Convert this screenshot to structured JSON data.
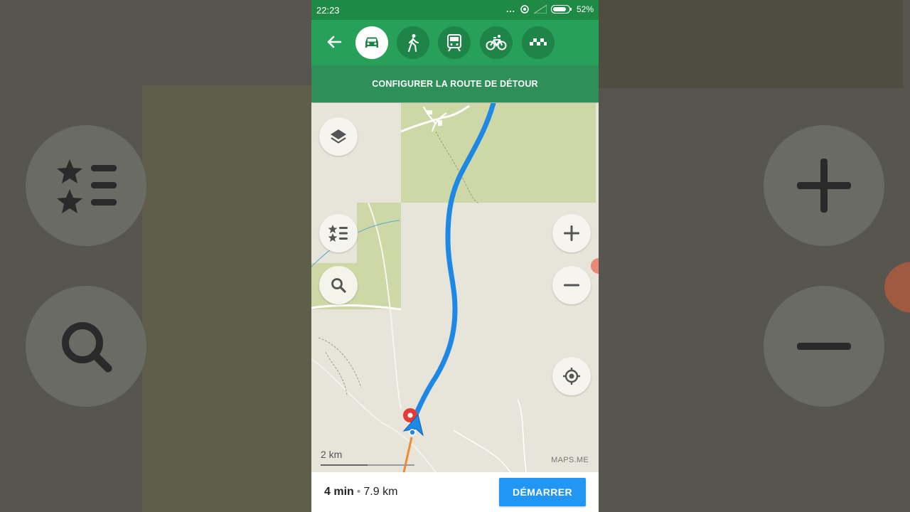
{
  "status_bar": {
    "time": "22:23",
    "dots": "...",
    "battery_percent": "52%"
  },
  "transport_modes": [
    {
      "name": "car",
      "icon": "car-icon",
      "selected": true
    },
    {
      "name": "walk",
      "icon": "walk-icon",
      "selected": false
    },
    {
      "name": "transit",
      "icon": "train-icon",
      "selected": false
    },
    {
      "name": "bicycle",
      "icon": "bicycle-icon",
      "selected": false
    },
    {
      "name": "taxi",
      "icon": "taxi-icon",
      "selected": false
    }
  ],
  "banner": {
    "label": "CONFIGURER LA ROUTE DE DÉTOUR"
  },
  "map": {
    "scale_label": "2 km",
    "attribution": "MAPS.ME"
  },
  "route_summary": {
    "duration": "4 min",
    "separator": "•",
    "distance": "7.9 km",
    "start_label": "DÉMARRER"
  },
  "colors": {
    "header_green": "#27a05a",
    "route_blue": "#1e88e5",
    "start_button": "#2196f3"
  }
}
